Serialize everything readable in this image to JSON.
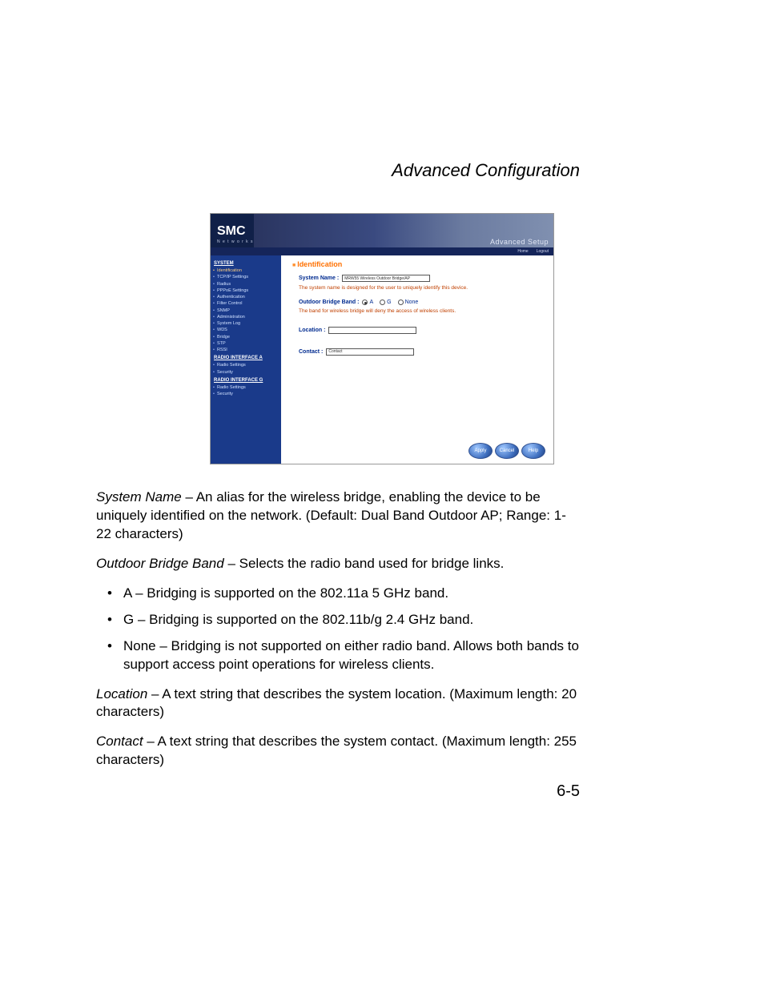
{
  "pageTitle": "Advanced Configuration",
  "pageNumber": "6-5",
  "screenshot": {
    "logo": "SMC",
    "logoSub": "N e t w o r k s",
    "bannerText": "Advanced Setup",
    "topbar": {
      "home": "Home",
      "logout": "Logout"
    },
    "sidebar": {
      "sec1": "SYSTEM",
      "items1": {
        "0": "Identification",
        "1": "TCP/IP Settings",
        "2": "Radius",
        "3": "PPPoE Settings",
        "4": "Authentication",
        "5": "Filter Control",
        "6": "SNMP",
        "7": "Administration",
        "8": "System Log",
        "9": "WDS",
        "10": "Bridge",
        "11": "STP",
        "12": "RSSI"
      },
      "sec2": "RADIO INTERFACE A",
      "items2": {
        "0": "Radio Settings",
        "1": "Security"
      },
      "sec3": "RADIO INTERFACE G",
      "items3": {
        "0": "Radio Settings",
        "1": "Security"
      }
    },
    "content": {
      "heading": "Identification",
      "sysNameLabel": "System Name :",
      "sysNameValue": "MRW55 Wireless Outdoor Bridge/AP",
      "sysNameDesc": "The system name is designed for the user to uniquely identify this device.",
      "bandLabel": "Outdoor Bridge Band :",
      "bandA": "A",
      "bandG": "G",
      "bandNone": "None",
      "bandDesc": "The band for wireless bridge will deny the access of wireless clients.",
      "locationLabel": "Location :",
      "locationValue": "",
      "contactLabel": "Contact :",
      "contactValue": "Contact",
      "btnApply": "Apply",
      "btnCancel": "Cancel",
      "btnHelp": "Help"
    }
  },
  "text": {
    "p1a": "System Name",
    "p1b": " – An alias for the wireless bridge, enabling the device to be uniquely identified on the network. (Default: Dual Band Outdoor AP; Range: 1-22 characters)",
    "p2a": "Outdoor Bridge Band",
    "p2b": " – Selects the radio band used for bridge links.",
    "li1": "A – Bridging is supported on the 802.11a 5 GHz band.",
    "li2": "G – Bridging is supported on the 802.11b/g 2.4 GHz band.",
    "li3": "None – Bridging is not supported on either radio band. Allows both bands to support access point operations for wireless clients.",
    "p3a": "Location",
    "p3b": " –  A text string that describes the system location. (Maximum length: 20 characters)",
    "p4a": "Contact",
    "p4b": " – A text string that describes the system contact. (Maximum length: 255 characters)"
  }
}
